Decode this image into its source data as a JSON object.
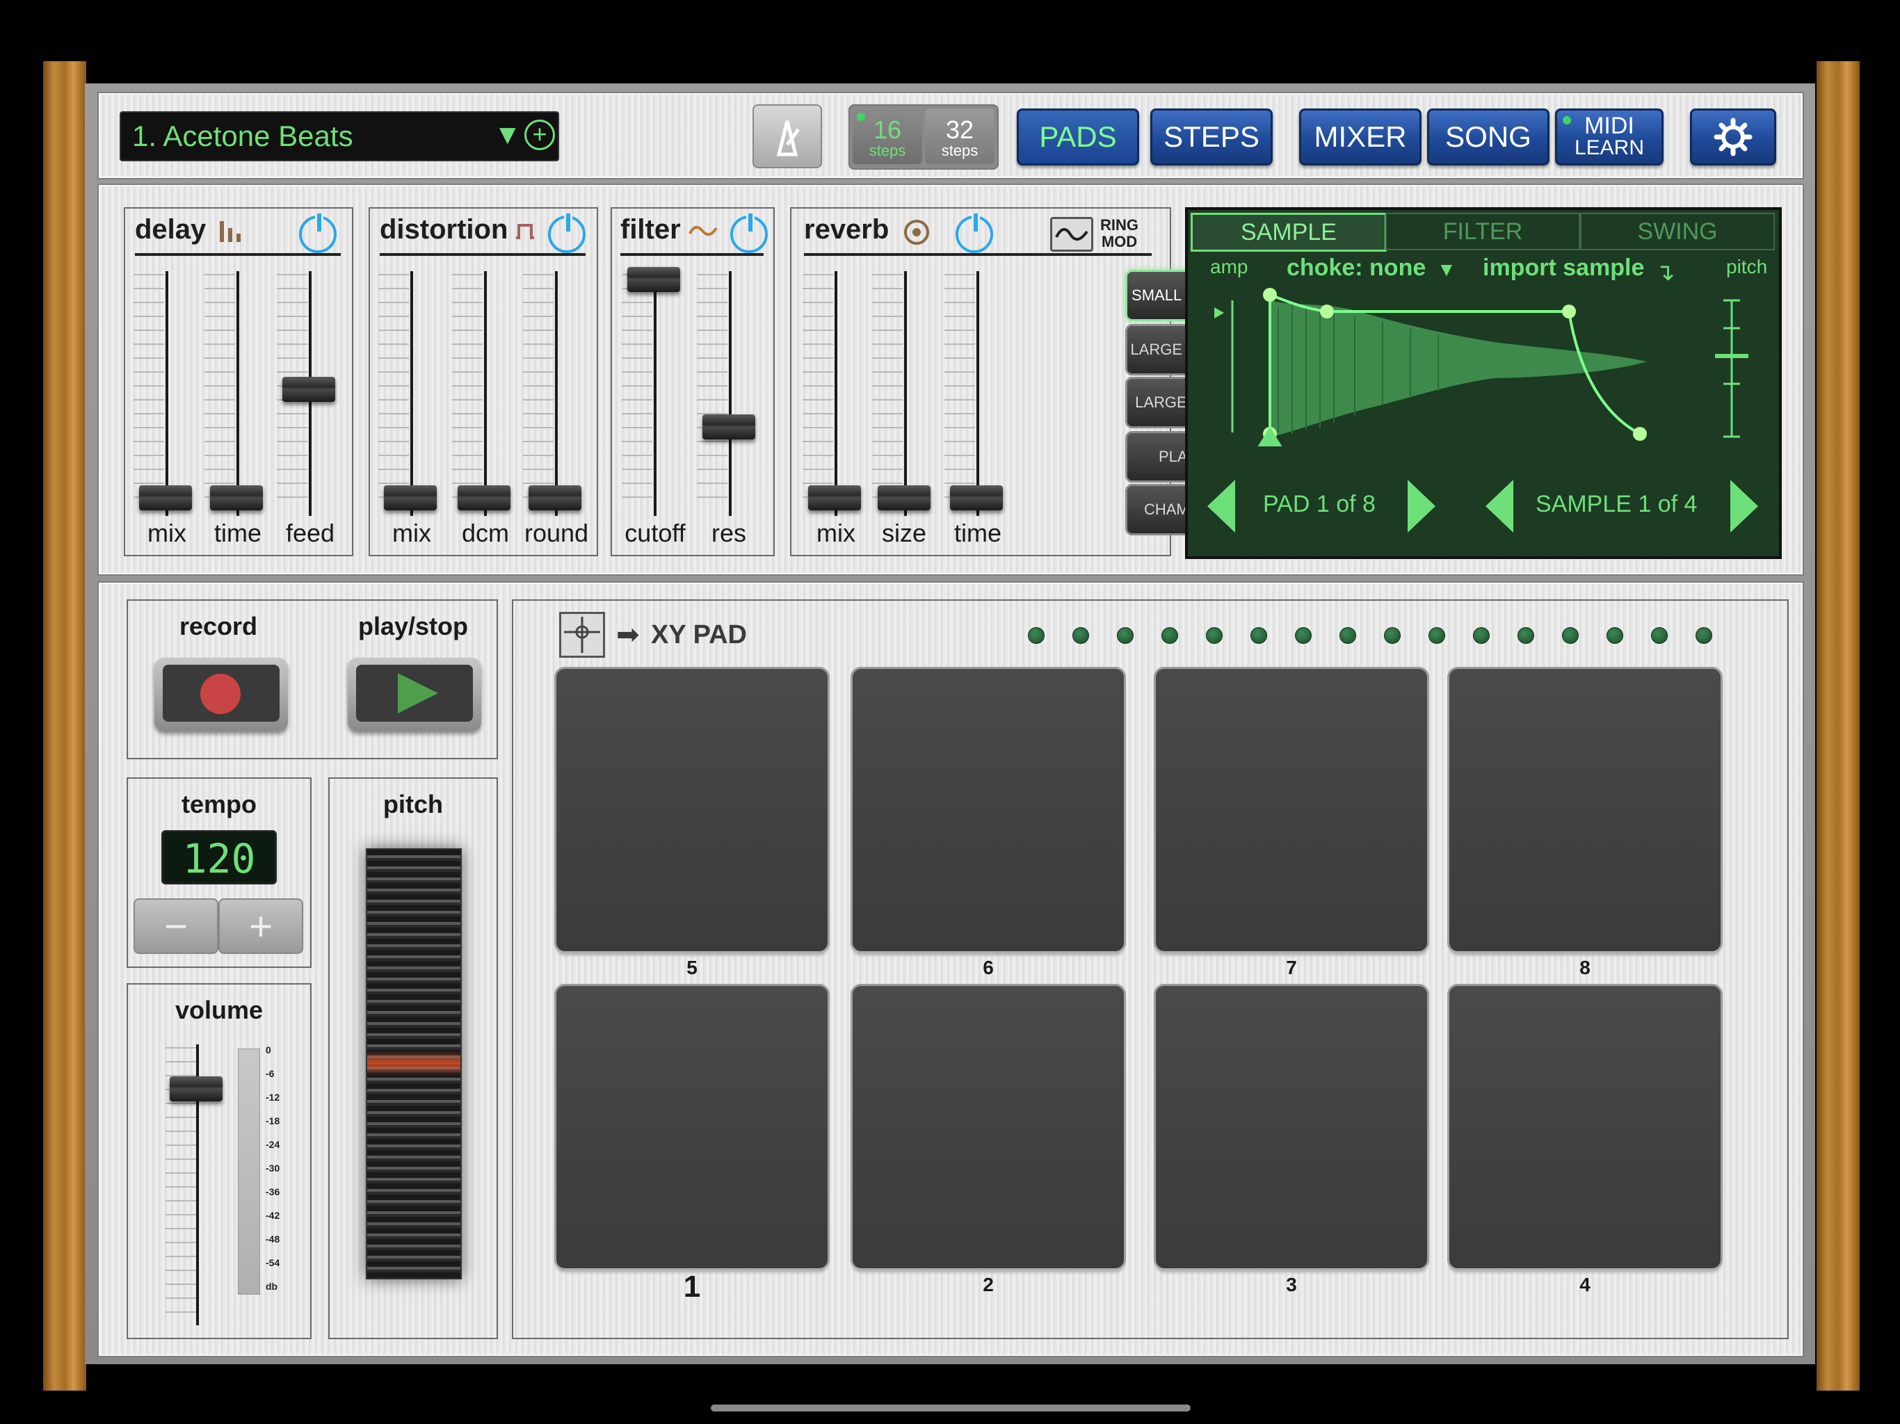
{
  "toolbar": {
    "kit_name": "1. Acetone Beats",
    "steps_16": "16",
    "steps_32": "32",
    "steps_word": "steps",
    "pads": "PADS",
    "steps": "STEPS",
    "mixer": "MIXER",
    "song": "SONG",
    "midi": "MIDI",
    "learn": "LEARN"
  },
  "effects": {
    "delay": {
      "title": "delay",
      "labels": [
        "mix",
        "time",
        "feed"
      ]
    },
    "distortion": {
      "title": "distortion",
      "labels": [
        "mix",
        "dcm",
        "round"
      ]
    },
    "filter": {
      "title": "filter",
      "labels": [
        "cutoff",
        "res"
      ]
    },
    "reverb": {
      "title": "reverb",
      "labels": [
        "mix",
        "size",
        "time"
      ],
      "ring_mod_1": "RING",
      "ring_mod_2": "MOD",
      "presets": [
        "SMALL ROOM",
        "LARGE ROOM",
        "LARGE HALL",
        "PLATE",
        "CHAMBER"
      ],
      "selected_preset": "SMALL ROOM"
    }
  },
  "sample_panel": {
    "tabs": [
      "SAMPLE",
      "FILTER",
      "SWING"
    ],
    "active_tab": "SAMPLE",
    "amp": "amp",
    "choke": "choke: none",
    "import": "import sample",
    "pitch": "pitch",
    "pad_nav": "PAD 1 of 8",
    "sample_nav": "SAMPLE 1 of 4",
    "accent": "#6ee07a"
  },
  "transport": {
    "record": "record",
    "play_stop": "play/stop"
  },
  "tempo": {
    "title": "tempo",
    "value": "120",
    "minus": "−",
    "plus": "+"
  },
  "pitch": {
    "title": "pitch"
  },
  "volume": {
    "title": "volume",
    "scale": [
      "0",
      "-6",
      "-12",
      "-18",
      "-24",
      "-30",
      "-36",
      "-42",
      "-48",
      "-54",
      "db"
    ]
  },
  "pads_area": {
    "xy_pad": "XY PAD",
    "top_row": [
      "5",
      "6",
      "7",
      "8"
    ],
    "bottom_row": [
      "1",
      "2",
      "3",
      "4"
    ],
    "led_count": 16
  }
}
